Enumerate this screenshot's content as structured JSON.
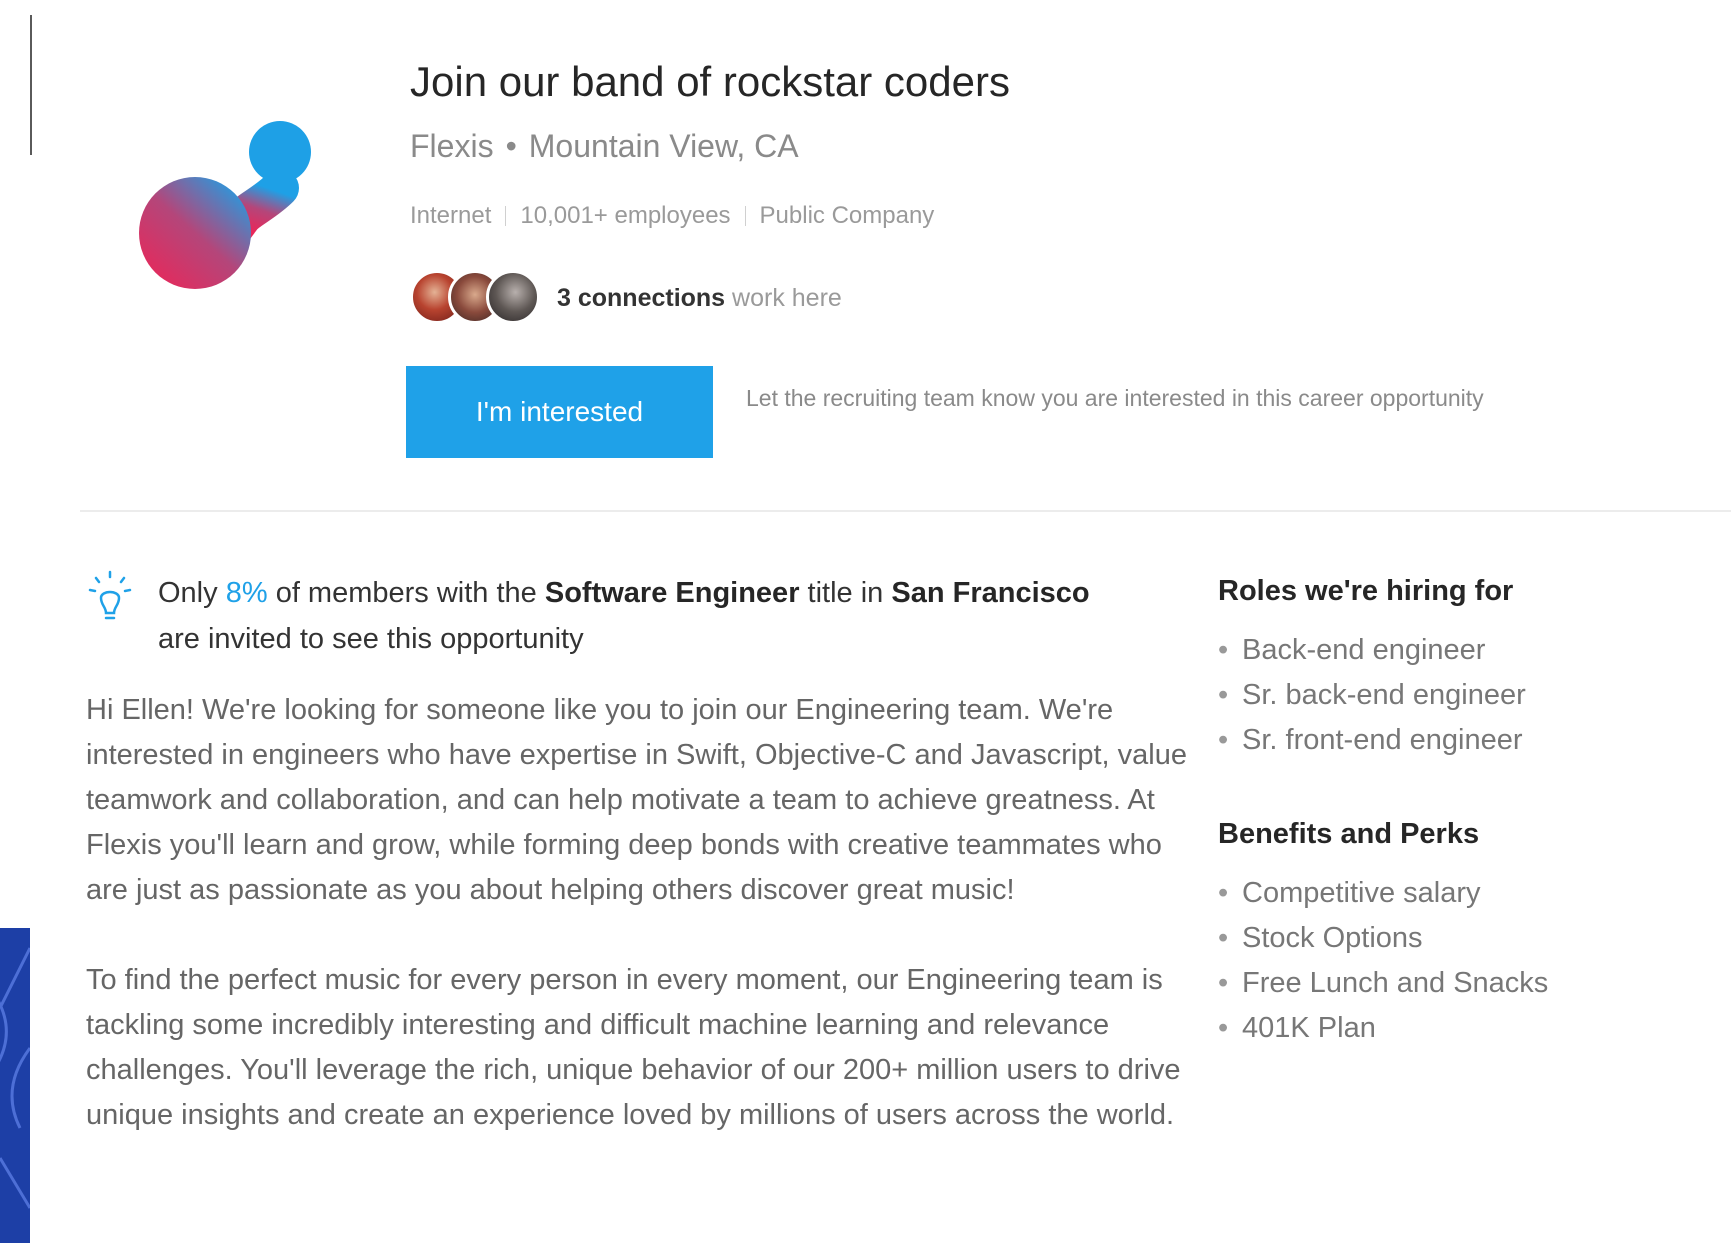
{
  "job": {
    "title": "Join our band of rockstar coders",
    "company": "Flexis",
    "location": "Mountain View, CA",
    "industry": "Internet",
    "size": "10,001+ employees",
    "company_type": "Public Company"
  },
  "connections": {
    "count_text": "3 connections",
    "suffix": "work here"
  },
  "interest": {
    "button_label": "I'm interested",
    "description": "Let the recruiting team know you are interested in this career opportunity"
  },
  "tip": {
    "prefix": "Only",
    "percent": "8%",
    "middle": "of members with the",
    "title": "Software Engineer",
    "middle2": "title in",
    "location": "San Francisco",
    "suffix": "are invited to see this opportunity"
  },
  "description": {
    "paragraph1": "Hi Ellen! We're looking for someone like you to join our Engineering team. We're interested in engineers who have expertise in Swift, Objective-C and Javascript, value teamwork and collaboration, and can help motivate a team to achieve greatness. At Flexis you'll learn and grow, while forming deep bonds with creative teammates who are just as passionate as you about helping others discover great music!",
    "paragraph2": "To find the perfect music for every person in every moment, our Engineering team is tackling some incredibly interesting and difficult machine learning and relevance challenges. You'll leverage the rich, unique behavior of our 200+ million users to drive unique insights and create an experience loved by millions of users across the world."
  },
  "sidebar": {
    "roles_heading": "Roles we're hiring for",
    "roles": [
      "Back-end engineer",
      "Sr. back-end engineer",
      "Sr. front-end engineer"
    ],
    "benefits_heading": "Benefits and Perks",
    "benefits": [
      "Competitive salary",
      "Stock Options",
      "Free Lunch and Snacks",
      "401K Plan"
    ]
  },
  "colors": {
    "accent": "#1fa1e8",
    "logo_top": "#1ea0e6",
    "logo_bottom": "#e8285a"
  },
  "icons": {
    "tip": "lightbulb-icon",
    "logo": "company-logo"
  }
}
